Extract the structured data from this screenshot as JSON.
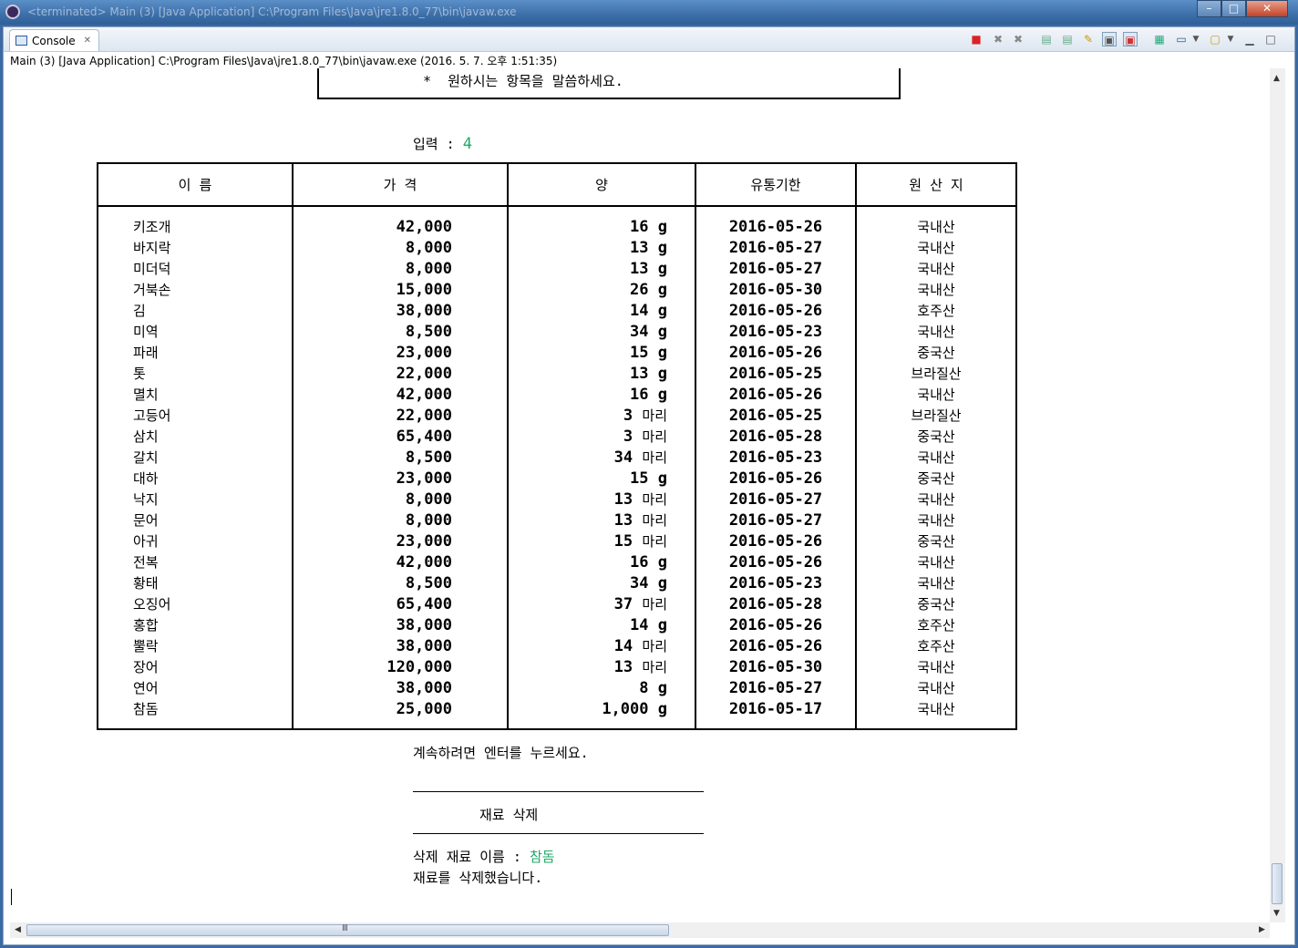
{
  "window": {
    "title": "<terminated> Main (3) [Java Application] C:\\Program Files\\Java\\jre1.8.0_77\\bin\\javaw.exe",
    "minimize_label": "–",
    "maximize_label": "□",
    "close_label": "✕"
  },
  "view": {
    "tab_label": "Console",
    "tab_close": "✕",
    "launch_info": "Main (3) [Java Application] C:\\Program Files\\Java\\jre1.8.0_77\\bin\\javaw.exe (2016. 5. 7. 오후 1:51:35)"
  },
  "toolbar": {
    "icons": [
      "terminate-icon",
      "remove-launch-icon",
      "remove-all-icon",
      "scroll-lock-icon",
      "word-wrap-icon",
      "pin-icon",
      "show-on-stdout-icon",
      "show-on-stderr-icon",
      "open-console-icon",
      "display-console-icon",
      "new-console-icon",
      "minimize-view-icon",
      "maximize-view-icon"
    ]
  },
  "console": {
    "prompt_line": "*  원하시는 항목을 말씀하세요.",
    "input_label": "입력 : ",
    "input_value": "4",
    "headers": [
      "이    름",
      "가  격",
      "양",
      "유통기한",
      "원 산 지"
    ],
    "rows": [
      {
        "name": "키조개",
        "price": "42,000",
        "qty": "16",
        "unit": "g",
        "date": "2016-05-26",
        "origin": "국내산"
      },
      {
        "name": "바지락",
        "price": "8,000",
        "qty": "13",
        "unit": "g",
        "date": "2016-05-27",
        "origin": "국내산"
      },
      {
        "name": "미더덕",
        "price": "8,000",
        "qty": "13",
        "unit": "g",
        "date": "2016-05-27",
        "origin": "국내산"
      },
      {
        "name": "거북손",
        "price": "15,000",
        "qty": "26",
        "unit": "g",
        "date": "2016-05-30",
        "origin": "국내산"
      },
      {
        "name": "김",
        "price": "38,000",
        "qty": "14",
        "unit": "g",
        "date": "2016-05-26",
        "origin": "호주산"
      },
      {
        "name": "미역",
        "price": "8,500",
        "qty": "34",
        "unit": "g",
        "date": "2016-05-23",
        "origin": "국내산"
      },
      {
        "name": "파래",
        "price": "23,000",
        "qty": "15",
        "unit": "g",
        "date": "2016-05-26",
        "origin": "중국산"
      },
      {
        "name": "톳",
        "price": "22,000",
        "qty": "13",
        "unit": "g",
        "date": "2016-05-25",
        "origin": "브라질산"
      },
      {
        "name": "멸치",
        "price": "42,000",
        "qty": "16",
        "unit": "g",
        "date": "2016-05-26",
        "origin": "국내산"
      },
      {
        "name": "고등어",
        "price": "22,000",
        "qty": "3",
        "unit": "마리",
        "date": "2016-05-25",
        "origin": "브라질산"
      },
      {
        "name": "삼치",
        "price": "65,400",
        "qty": "3",
        "unit": "마리",
        "date": "2016-05-28",
        "origin": "중국산"
      },
      {
        "name": "갈치",
        "price": "8,500",
        "qty": "34",
        "unit": "마리",
        "date": "2016-05-23",
        "origin": "국내산"
      },
      {
        "name": "대하",
        "price": "23,000",
        "qty": "15",
        "unit": "g",
        "date": "2016-05-26",
        "origin": "중국산"
      },
      {
        "name": "낙지",
        "price": "8,000",
        "qty": "13",
        "unit": "마리",
        "date": "2016-05-27",
        "origin": "국내산"
      },
      {
        "name": "문어",
        "price": "8,000",
        "qty": "13",
        "unit": "마리",
        "date": "2016-05-27",
        "origin": "국내산"
      },
      {
        "name": "아귀",
        "price": "23,000",
        "qty": "15",
        "unit": "마리",
        "date": "2016-05-26",
        "origin": "중국산"
      },
      {
        "name": "전복",
        "price": "42,000",
        "qty": "16",
        "unit": "g",
        "date": "2016-05-26",
        "origin": "국내산"
      },
      {
        "name": "황태",
        "price": "8,500",
        "qty": "34",
        "unit": "g",
        "date": "2016-05-23",
        "origin": "국내산"
      },
      {
        "name": "오징어",
        "price": "65,400",
        "qty": "37",
        "unit": "마리",
        "date": "2016-05-28",
        "origin": "중국산"
      },
      {
        "name": "홍합",
        "price": "38,000",
        "qty": "14",
        "unit": "g",
        "date": "2016-05-26",
        "origin": "호주산"
      },
      {
        "name": "뿔락",
        "price": "38,000",
        "qty": "14",
        "unit": "마리",
        "date": "2016-05-26",
        "origin": "호주산"
      },
      {
        "name": "장어",
        "price": "120,000",
        "qty": "13",
        "unit": "마리",
        "date": "2016-05-30",
        "origin": "국내산"
      },
      {
        "name": "연어",
        "price": "38,000",
        "qty": "8",
        "unit": "g",
        "date": "2016-05-27",
        "origin": "국내산"
      },
      {
        "name": "참돔",
        "price": "25,000",
        "qty": "1,000",
        "unit": "g",
        "date": "2016-05-17",
        "origin": "국내산"
      }
    ],
    "continue_msg": "계속하려면 엔터를 누르세요.",
    "section_title": "재료 삭제",
    "delete_label": "삭제 재료 이름 : ",
    "delete_value": "참돔",
    "deleted_msg": "재료를 삭제했습니다."
  },
  "scrollbar": {
    "h_grip": "Ⅲ"
  }
}
